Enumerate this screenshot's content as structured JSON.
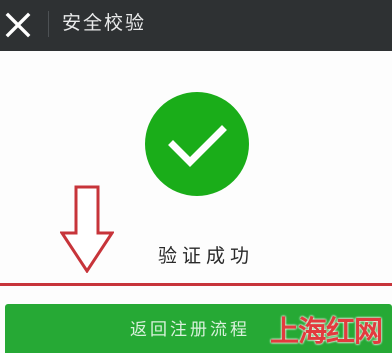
{
  "header": {
    "title": "安全校验",
    "close_icon": "close-icon"
  },
  "status": {
    "icon": "check-circle-icon",
    "text": "验证成功",
    "icon_color": "#1aad19"
  },
  "annotation": {
    "arrow_icon": "down-arrow-icon",
    "color": "#c7343a"
  },
  "action": {
    "return_label": "返回注册流程",
    "button_color": "#26a935"
  },
  "watermark": {
    "text": "上海红网"
  }
}
